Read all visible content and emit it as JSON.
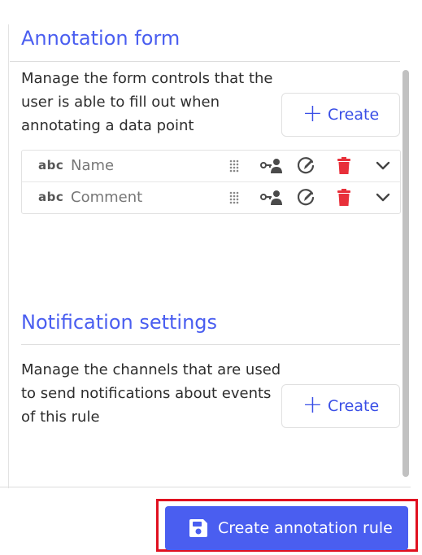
{
  "annotation_form": {
    "title": "Annotation form",
    "description": "Manage the form controls that the user is able to fill out when annotating a data point",
    "create_label": "Create",
    "controls": [
      {
        "type": "abc",
        "label": "Name"
      },
      {
        "type": "abc",
        "label": "Comment"
      }
    ]
  },
  "notification_settings": {
    "title": "Notification settings",
    "description": "Manage the channels that are used to send notifications about events of this rule",
    "create_label": "Create"
  },
  "footer": {
    "submit_label": "Create annotation rule"
  },
  "colors": {
    "accent": "#4a5ef0",
    "delete": "#e8303a",
    "highlight": "#e01020"
  },
  "icons": [
    "abc-icon",
    "drag-handle-icon",
    "user-key-icon",
    "edit-icon",
    "trash-icon",
    "chevron-down-icon",
    "plus-icon",
    "save-icon"
  ]
}
